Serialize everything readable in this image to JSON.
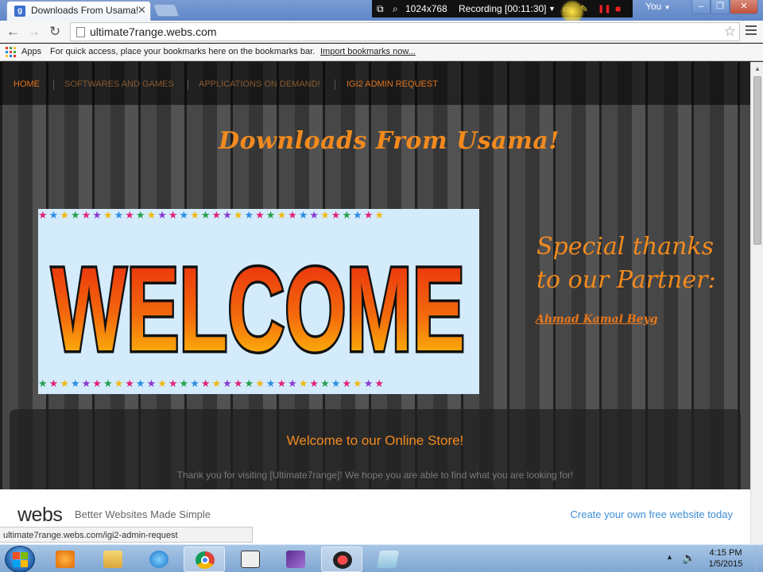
{
  "browser": {
    "tab_title": "Downloads From Usama!",
    "tab_close": "✕",
    "favicon_letter": "g",
    "url": "ultimate7range.webs.com",
    "profile": "You",
    "bookmarks_apps": "Apps",
    "bookmarks_hint": "For quick access, place your bookmarks here on the bookmarks bar.",
    "bookmarks_import": "Import bookmarks now...",
    "status_url": "ultimate7range.webs.com/igi2-admin-request"
  },
  "recorder": {
    "resolution": "1024x768",
    "status": "Recording [00:11:30]"
  },
  "site": {
    "nav": [
      "HOME",
      "SOFTWARES AND GAMES",
      "APPLICATIONS ON DEMAND!",
      "IGI2 ADMIN REQUEST"
    ],
    "title": "Downloads From Usama!",
    "banner_text": "WELCOME",
    "thanks_line1": "Special thanks",
    "thanks_line2": "to our Partner:",
    "partner_name": "Ahmad Kamal Beyg",
    "store_heading": "Welcome to our Online Store!",
    "store_message": "Thank you for visiting [Ultimate7range]!  We hope you are able to find what you are looking for!"
  },
  "webs_footer": {
    "logo": "webs",
    "tagline": "Better Websites Made Simple",
    "cta": "Create your own free website today"
  },
  "taskbar": {
    "time": "4:15 PM",
    "date": "1/5/2015",
    "apps": [
      "windows-media-player",
      "file-explorer",
      "internet-explorer",
      "chrome",
      "film-editor",
      "visual-studio",
      "recorder",
      "notepad"
    ]
  },
  "colors": {
    "accent_orange": "#f28a1e",
    "footer_link": "#3d8ed6"
  }
}
